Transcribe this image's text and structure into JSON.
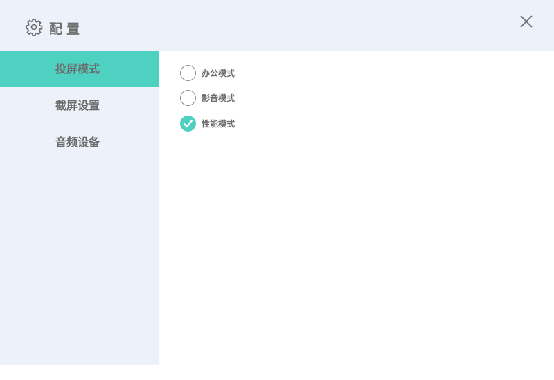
{
  "header": {
    "title": "配置",
    "icon": "gear-icon",
    "close_icon": "close-icon"
  },
  "sidebar": {
    "items": [
      {
        "label": "投屏模式",
        "active": true
      },
      {
        "label": "截屏设置",
        "active": false
      },
      {
        "label": "音频设备",
        "active": false
      }
    ]
  },
  "modes": {
    "options": [
      {
        "label": "办公模式",
        "checked": false
      },
      {
        "label": "影音模式",
        "checked": false
      },
      {
        "label": "性能模式",
        "checked": true
      }
    ]
  },
  "colors": {
    "accent": "#4fd1c1",
    "panel": "#edf1fa",
    "text": "#6b6b6b"
  }
}
